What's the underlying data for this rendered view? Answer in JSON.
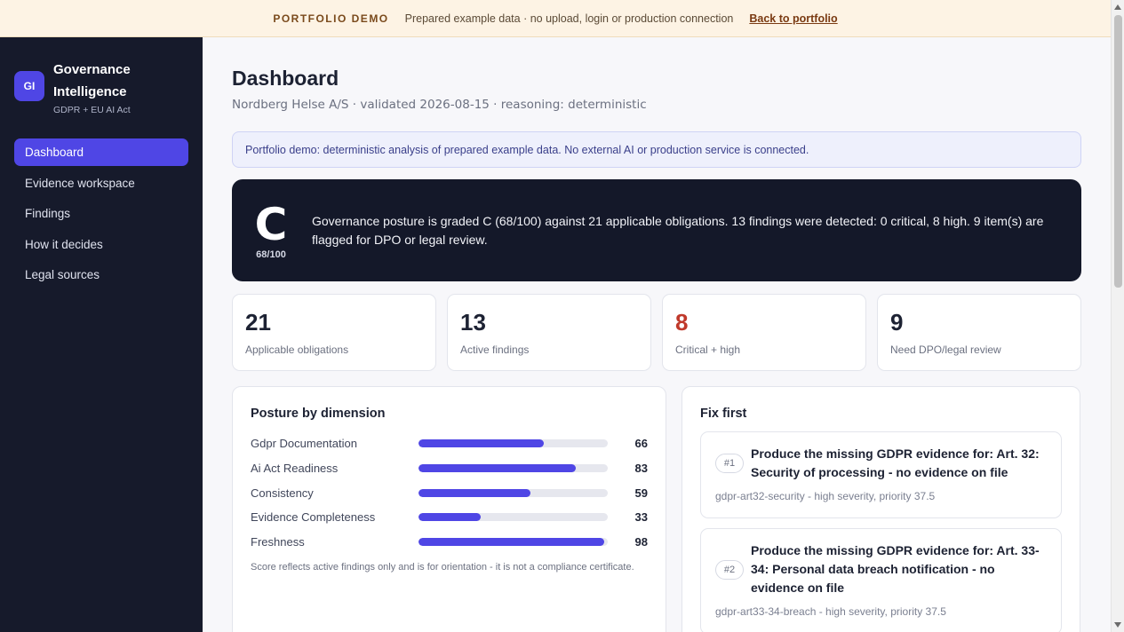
{
  "banner": {
    "tag": "PORTFOLIO DEMO",
    "message": "Prepared example data · no upload, login or production connection",
    "back_link": "Back to portfolio"
  },
  "sidebar": {
    "logo_text": "GI",
    "brand_line1": "Governance",
    "brand_line2": "Intelligence",
    "brand_sub": "GDPR + EU AI Act",
    "items": [
      {
        "label": "Dashboard",
        "active": true
      },
      {
        "label": "Evidence workspace",
        "active": false
      },
      {
        "label": "Findings",
        "active": false
      },
      {
        "label": "How it decides",
        "active": false
      },
      {
        "label": "Legal sources",
        "active": false
      }
    ]
  },
  "page": {
    "title": "Dashboard",
    "subtitle": "Nordberg Helse A/S · validated 2026-08-15 · reasoning: deterministic",
    "notice": "Portfolio demo: deterministic analysis of prepared example data. No external AI or production service is connected."
  },
  "grade": {
    "letter": "C",
    "score": "68/100",
    "summary": "Governance posture is graded C (68/100) against 21 applicable obligations. 13 findings were detected: 0 critical, 8 high. 9 item(s) are flagged for DPO or legal review."
  },
  "stats": [
    {
      "value": "21",
      "label": "Applicable obligations"
    },
    {
      "value": "13",
      "label": "Active findings"
    },
    {
      "value": "8",
      "label": "Critical + high"
    },
    {
      "value": "9",
      "label": "Need DPO/legal review"
    }
  ],
  "posture": {
    "title": "Posture by dimension",
    "dimensions": [
      {
        "label": "Gdpr Documentation",
        "value": 66
      },
      {
        "label": "Ai Act Readiness",
        "value": 83
      },
      {
        "label": "Consistency",
        "value": 59
      },
      {
        "label": "Evidence Completeness",
        "value": 33
      },
      {
        "label": "Freshness",
        "value": 98
      }
    ],
    "note": "Score reflects active findings only and is for orientation - it is not a compliance certificate."
  },
  "fix_first": {
    "title": "Fix first",
    "items": [
      {
        "rank": "#1",
        "title": "Produce the missing GDPR evidence for: Art. 32: Security of processing - no evidence on file",
        "meta": "gdpr-art32-security - high severity, priority 37.5"
      },
      {
        "rank": "#2",
        "title": "Produce the missing GDPR evidence for: Art. 33-34: Personal data breach notification - no evidence on file",
        "meta": "gdpr-art33-34-breach - high severity, priority 37.5"
      }
    ]
  },
  "colors": {
    "accent": "#4f46e5",
    "sidebar_bg": "#161a2b",
    "critical": "#c0392b",
    "banner_bg": "#fdf3e4"
  }
}
